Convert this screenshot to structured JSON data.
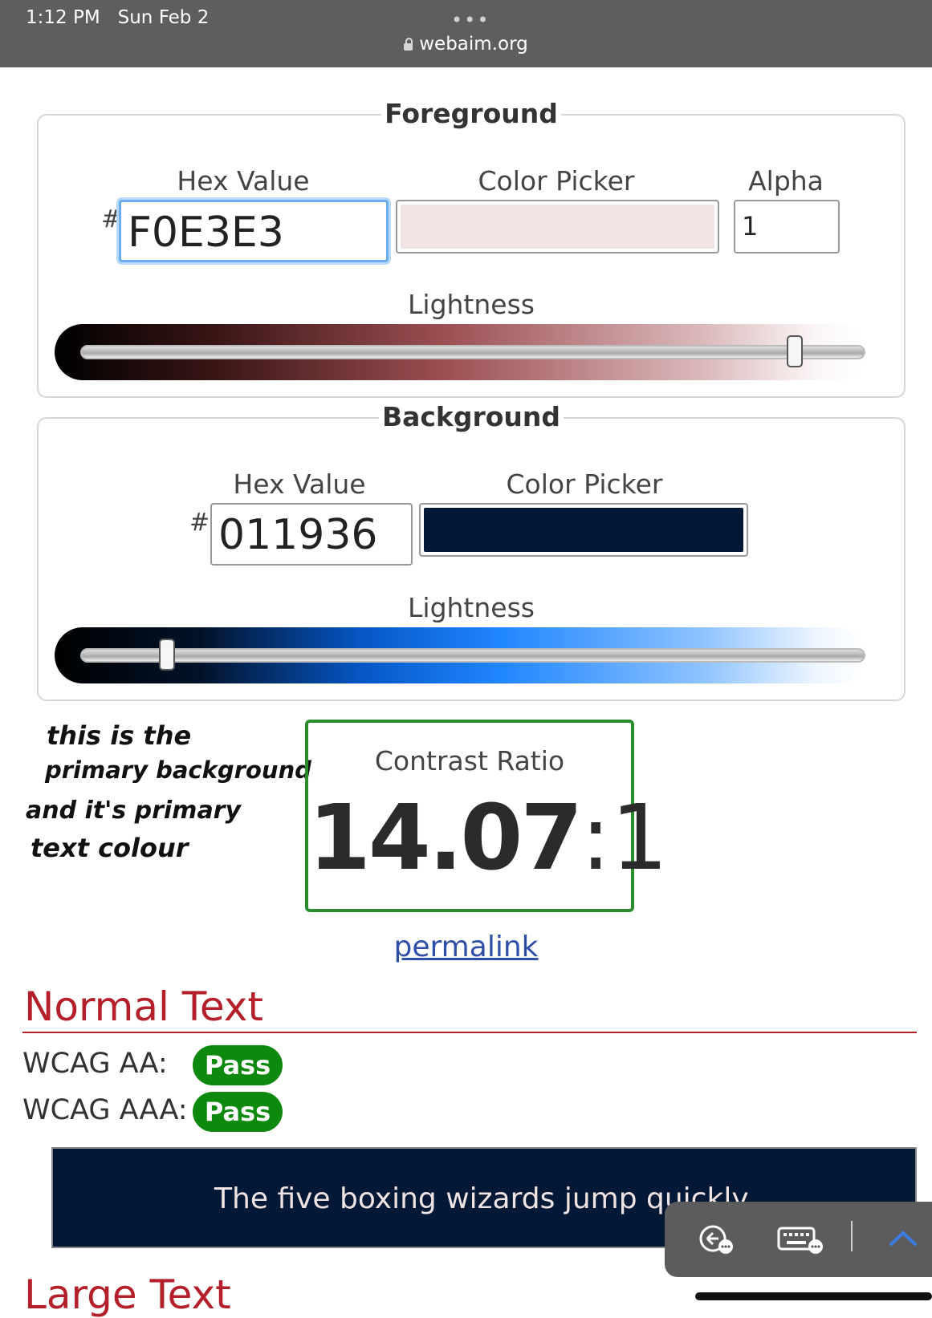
{
  "status_bar": {
    "time": "1:12 PM",
    "date": "Sun Feb 2",
    "dots": "•••",
    "url": "webaim.org"
  },
  "foreground": {
    "legend": "Foreground",
    "hex_label": "Hex Value",
    "hash": "#",
    "hex_value": "F0E3E3",
    "picker_label": "Color Picker",
    "picker_color": "#F0E3E3",
    "alpha_label": "Alpha",
    "alpha_value": "1",
    "lightness_label": "Lightness",
    "lightness_fraction": 0.91
  },
  "background": {
    "legend": "Background",
    "hex_label": "Hex Value",
    "hash": "#",
    "hex_value": "011936",
    "picker_label": "Color Picker",
    "picker_color": "#011936",
    "lightness_label": "Lightness",
    "lightness_fraction": 0.11
  },
  "annotation": {
    "line1": "this is the",
    "line2": "primary background",
    "line3": "and it's primary",
    "line4": "text colour"
  },
  "contrast": {
    "label": "Contrast Ratio",
    "ratio_main": "14.07",
    "ratio_sep": ":",
    "ratio_tail": "1",
    "border_color": "#2a8c2a"
  },
  "permalink": "permalink",
  "normal_text": {
    "title": "Normal Text",
    "aa_label": "WCAG AA:",
    "aa_result": "Pass",
    "aaa_label": "WCAG AAA:",
    "aaa_result": "Pass",
    "sample": "The five boxing wizards jump quickly."
  },
  "large_text": {
    "title": "Large Text"
  },
  "keyboard_toolbar": {
    "icons": [
      "undo-bubble-icon",
      "keyboard-icon",
      "chevron-up-icon"
    ]
  },
  "colors": {
    "accent_red": "#b51f29",
    "pass_green": "#0d8a0d",
    "link_blue": "#2e4fa8"
  }
}
